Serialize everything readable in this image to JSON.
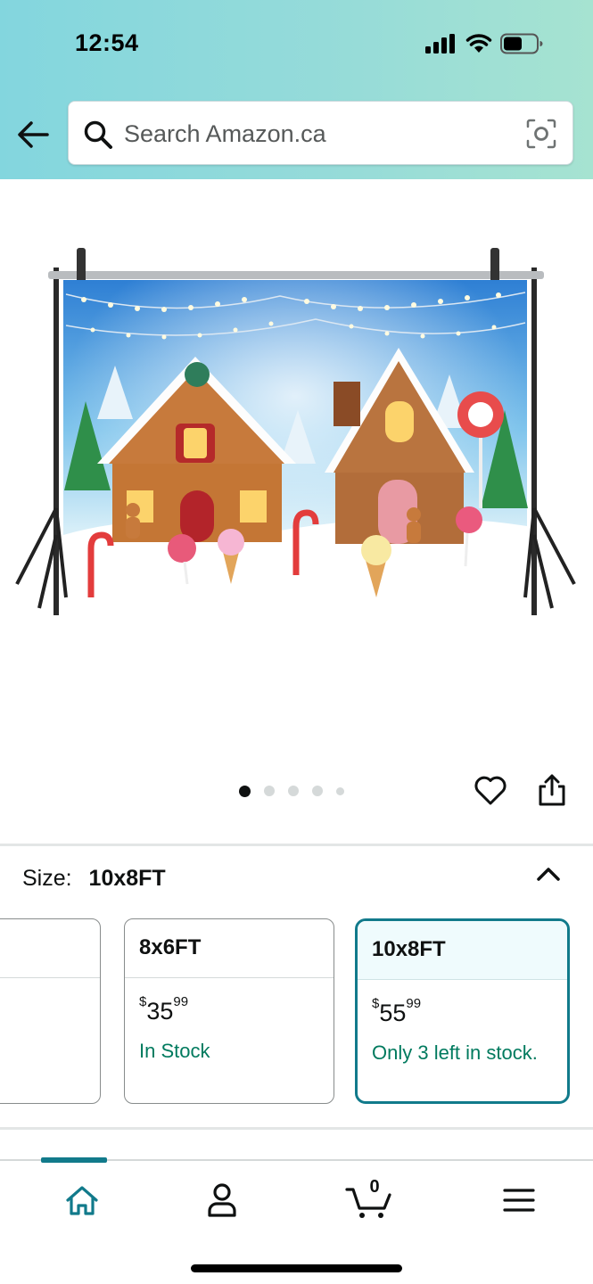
{
  "status_bar": {
    "time": "12:54",
    "icons": [
      "signal-icon",
      "wifi-icon",
      "battery-icon"
    ]
  },
  "header": {
    "back_icon": "back-arrow-icon",
    "search": {
      "placeholder": "Search Amazon.ca",
      "value": "",
      "left_icon": "search-icon",
      "right_icon": "camera-lens-icon"
    },
    "gradient_colors": [
      "#83d6de",
      "#a6e3d1"
    ]
  },
  "product_image": {
    "description_icon": "gingerbread-houses-backdrop-image"
  },
  "carousel": {
    "dot_count": 5,
    "active_index": 0,
    "actions": [
      "heart-icon",
      "share-icon"
    ]
  },
  "size_selector": {
    "label": "Size:",
    "selected": "10x8FT",
    "toggle_icon": "chevron-up-icon",
    "options": [
      {
        "title": "",
        "price_symbol": "",
        "price_whole": "",
        "price_cents": "",
        "stock": "",
        "selected": false
      },
      {
        "title": "8x6FT",
        "price_symbol": "$",
        "price_whole": "35",
        "price_cents": "99",
        "stock": "In Stock",
        "selected": false
      },
      {
        "title": "10x8FT",
        "price_symbol": "$",
        "price_whole": "55",
        "price_cents": "99",
        "stock": "Only 3 left in stock.",
        "selected": true
      }
    ]
  },
  "bottom_nav": {
    "items": [
      "home-icon",
      "account-icon",
      "cart-icon",
      "menu-icon"
    ],
    "active": "home-icon",
    "cart_count": "0",
    "accent_color": "#117a8b"
  },
  "colors": {
    "accent": "#117a8b",
    "stock_green": "#007a5e",
    "text": "#0f1111"
  }
}
